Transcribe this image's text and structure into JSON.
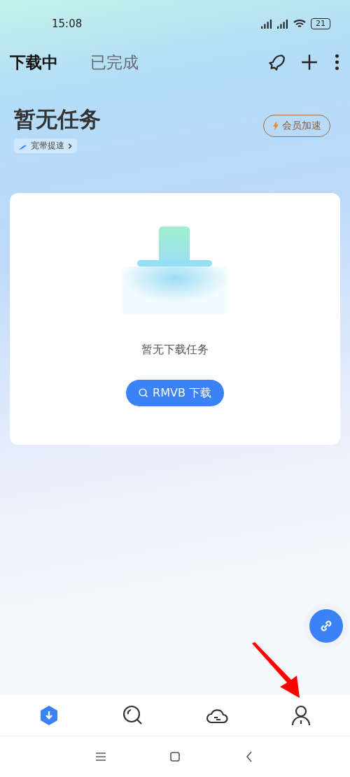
{
  "status_bar": {
    "time": "15:08",
    "battery": "21"
  },
  "tabs": [
    {
      "label": "下载中",
      "selected": true
    },
    {
      "label": "已完成",
      "selected": false
    }
  ],
  "header": {
    "title": "暂无任务",
    "speed_link": "宽带提速",
    "vip_button": "会员加速"
  },
  "empty_card": {
    "message": "暂无下载任务",
    "button": "RMVB 下载"
  },
  "bottom_nav": [
    {
      "kind": "download",
      "selected": true
    },
    {
      "kind": "discover",
      "selected": false
    },
    {
      "kind": "cloud",
      "selected": false
    },
    {
      "kind": "profile",
      "selected": false
    }
  ]
}
